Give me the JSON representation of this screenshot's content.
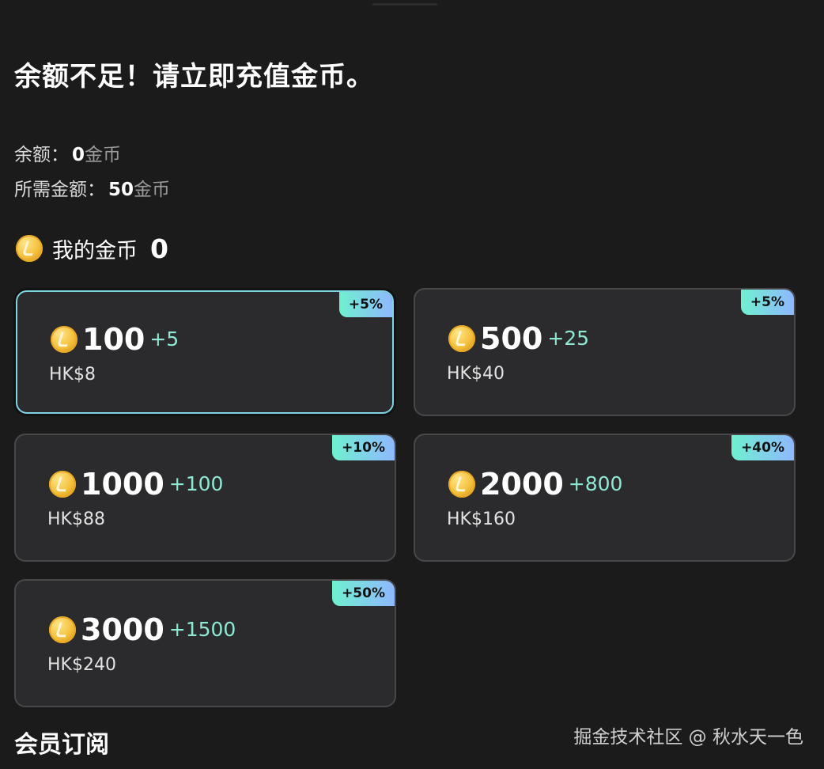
{
  "header": {
    "title": "余额不足！请立即充值金币。"
  },
  "balance": {
    "label": "余额：",
    "value": "0",
    "unit": "金币"
  },
  "required": {
    "label": "所需金额：",
    "value": "50",
    "unit": "金币"
  },
  "my_coins": {
    "icon": "coin-icon",
    "label": "我的金币",
    "value": "0"
  },
  "packages": [
    {
      "tag": "+5%",
      "amount": "100",
      "bonus": "+5",
      "price": "HK$8",
      "selected": true
    },
    {
      "tag": "+5%",
      "amount": "500",
      "bonus": "+25",
      "price": "HK$40",
      "selected": false
    },
    {
      "tag": "+10%",
      "amount": "1000",
      "bonus": "+100",
      "price": "HK$88",
      "selected": false
    },
    {
      "tag": "+40%",
      "amount": "2000",
      "bonus": "+800",
      "price": "HK$160",
      "selected": false
    },
    {
      "tag": "+50%",
      "amount": "3000",
      "bonus": "+1500",
      "price": "HK$240",
      "selected": false
    }
  ],
  "membership": {
    "title": "会员订阅"
  },
  "watermark": "掘金技术社区 @ 秋水天一色",
  "colors": {
    "background": "#1b1b1c",
    "card": "#2b2b2d",
    "selected_border": "#7fd3e4",
    "bonus_text": "#8ee8d4",
    "tag_gradient_start": "#6ff0cf",
    "tag_gradient_end": "#8fb8ff",
    "coin_gold": "#f4bf3a"
  }
}
